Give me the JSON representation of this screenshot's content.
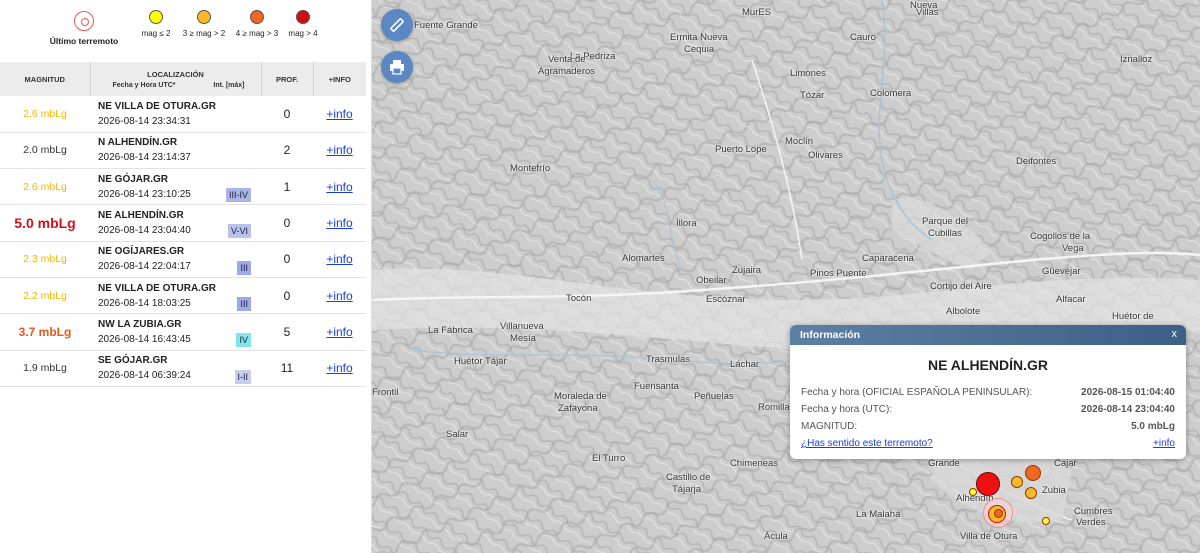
{
  "legend": {
    "last_quake_label": "Último terremoto",
    "items": [
      {
        "label": "mag ≤ 2",
        "color": "#ffff00"
      },
      {
        "label": "3 ≥ mag > 2",
        "color": "#fbb829"
      },
      {
        "label": "4 ≥ mag > 3",
        "color": "#f26522"
      },
      {
        "label": "mag > 4",
        "color": "#d01010"
      }
    ]
  },
  "table": {
    "headers": {
      "magnitude": "MAGNITUD",
      "location": "LOCALIZACIÓN",
      "datetime": "Fecha y Hora UTC*",
      "intensity": "Int. [máx]",
      "depth": "PROF.",
      "info": "+INFO"
    },
    "rows": [
      {
        "magnitude": "2.6 mbLg",
        "location": "NE VILLA DE OTURA.GR",
        "datetime": "2026-08-14 23:34:31",
        "intensity": "",
        "depth": "0",
        "info": "+info"
      },
      {
        "magnitude": "2.0 mbLg",
        "location": "N ALHENDÍN.GR",
        "datetime": "2026-08-14 23:14:37",
        "intensity": "",
        "depth": "2",
        "info": "+info"
      },
      {
        "magnitude": "2.6 mbLg",
        "location": "NE GÓJAR.GR",
        "datetime": "2026-08-14 23:10:25",
        "intensity": "III-IV",
        "depth": "1",
        "info": "+info"
      },
      {
        "magnitude": "5.0 mbLg",
        "location": "NE ALHENDÍN.GR",
        "datetime": "2026-08-14 23:04:40",
        "intensity": "V-VI",
        "depth": "0",
        "info": "+info"
      },
      {
        "magnitude": "2.3 mbLg",
        "location": "NE OGÍJARES.GR",
        "datetime": "2026-08-14 22:04:17",
        "intensity": "III",
        "depth": "0",
        "info": "+info"
      },
      {
        "magnitude": "2.2 mbLg",
        "location": "NE VILLA DE OTURA.GR",
        "datetime": "2026-08-14 18:03:25",
        "intensity": "III",
        "depth": "0",
        "info": "+info"
      },
      {
        "magnitude": "3.7 mbLg",
        "location": "NW LA ZUBIA.GR",
        "datetime": "2026-08-14 16:43:45",
        "intensity": "IV",
        "depth": "5",
        "info": "+info"
      },
      {
        "magnitude": "1.9 mbLg",
        "location": "SE GÓJAR.GR",
        "datetime": "2026-08-14 06:39:24",
        "intensity": "I-II",
        "depth": "11",
        "info": "+info"
      }
    ]
  },
  "map": {
    "places": [
      "Fuente Grande",
      "MurES",
      "La Pedriza",
      "Ermita Nueva",
      "Cequia",
      "Cauro",
      "Venta de",
      "Agramaderos",
      "Limones",
      "Tózar",
      "Colomera",
      "Iznalloz",
      "Montefrío",
      "Puerto Lope",
      "Moclín",
      "Olivares",
      "Deifontes",
      "Íllora",
      "Parque del",
      "Cubillas",
      "Cogollos de la",
      "Vega",
      "Alomartes",
      "Obeilar",
      "Zujaira",
      "Pinos Puente",
      "Caparacena",
      "Güevéjar",
      "Tocón",
      "Escóznar",
      "Cortijo del Aire",
      "Albolote",
      "Alfacar",
      "La Fábrica",
      "Villanueva",
      "Mesía",
      "Huétor Tájar",
      "Trasmulas",
      "Láchar",
      "Huétor de",
      "Frontil",
      "Fuensanta",
      "Peñuelas",
      "Moraleda de",
      "Zafayona",
      "Romilla",
      "Salar",
      "El Turro",
      "Castillo de",
      "Tájarja",
      "Chimeneas",
      "Grande",
      "Cajar",
      "Zubia",
      "Alhendín",
      "La Malahá",
      "Cumbres",
      "Verdes",
      "Ácula",
      "Villa de Otura",
      "Nueva",
      "Villas"
    ],
    "measure_button": "ruler-icon",
    "print_button": "printer-icon"
  },
  "popup": {
    "header": "Información",
    "close": "x",
    "title": "NE ALHENDÍN.GR",
    "rows": [
      {
        "label": "Fecha y hora (OFICIAL ESPAÑOLA PENINSULAR):",
        "value": "2026-08-15 01:04:40"
      },
      {
        "label": "Fecha y hora (UTC):",
        "value": "2026-08-14 23:04:40"
      },
      {
        "label": "MAGNITUD:",
        "value": "5.0 mbLg"
      }
    ],
    "felt_link": "¿Has sentido este terremoto?",
    "info_link": "+info"
  }
}
